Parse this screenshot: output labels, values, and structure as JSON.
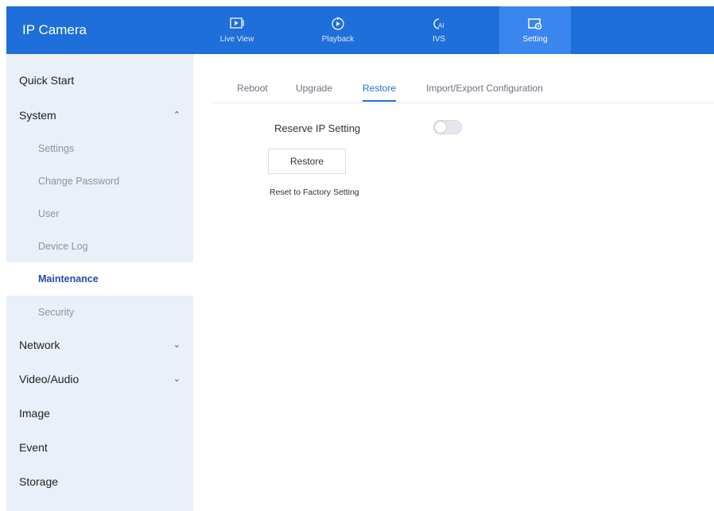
{
  "app": {
    "title": "IP Camera"
  },
  "nav": {
    "tabs": [
      {
        "label": "Live View",
        "icon": "live-view-icon",
        "active": false
      },
      {
        "label": "Playback",
        "icon": "playback-icon",
        "active": false
      },
      {
        "label": "IVS",
        "icon": "ivs-ai-icon",
        "active": false
      },
      {
        "label": "Setting",
        "icon": "setting-icon",
        "active": true
      }
    ]
  },
  "sidebar": {
    "items": [
      {
        "label": "Quick Start"
      },
      {
        "label": "System",
        "expanded": true
      },
      {
        "label": "Settings"
      },
      {
        "label": "Change Password"
      },
      {
        "label": "User"
      },
      {
        "label": "Device Log"
      },
      {
        "label": "Maintenance",
        "active": true
      },
      {
        "label": "Security"
      },
      {
        "label": "Network",
        "expanded": false
      },
      {
        "label": "Video/Audio",
        "expanded": false
      },
      {
        "label": "Image"
      },
      {
        "label": "Event"
      },
      {
        "label": "Storage"
      }
    ]
  },
  "subtabs": [
    {
      "label": "Reboot"
    },
    {
      "label": "Upgrade"
    },
    {
      "label": "Restore",
      "active": true
    },
    {
      "label": "Import/Export Configuration"
    }
  ],
  "restore": {
    "reserve_ip_label": "Reserve IP Setting",
    "reserve_ip_enabled": false,
    "button_label": "Restore",
    "description": "Reset to Factory Setting"
  },
  "colors": {
    "header": "#1e6fd9",
    "active_tab": "#3a86ee",
    "sidebar": "#eaf0f9",
    "accent": "#1e6fd9"
  }
}
